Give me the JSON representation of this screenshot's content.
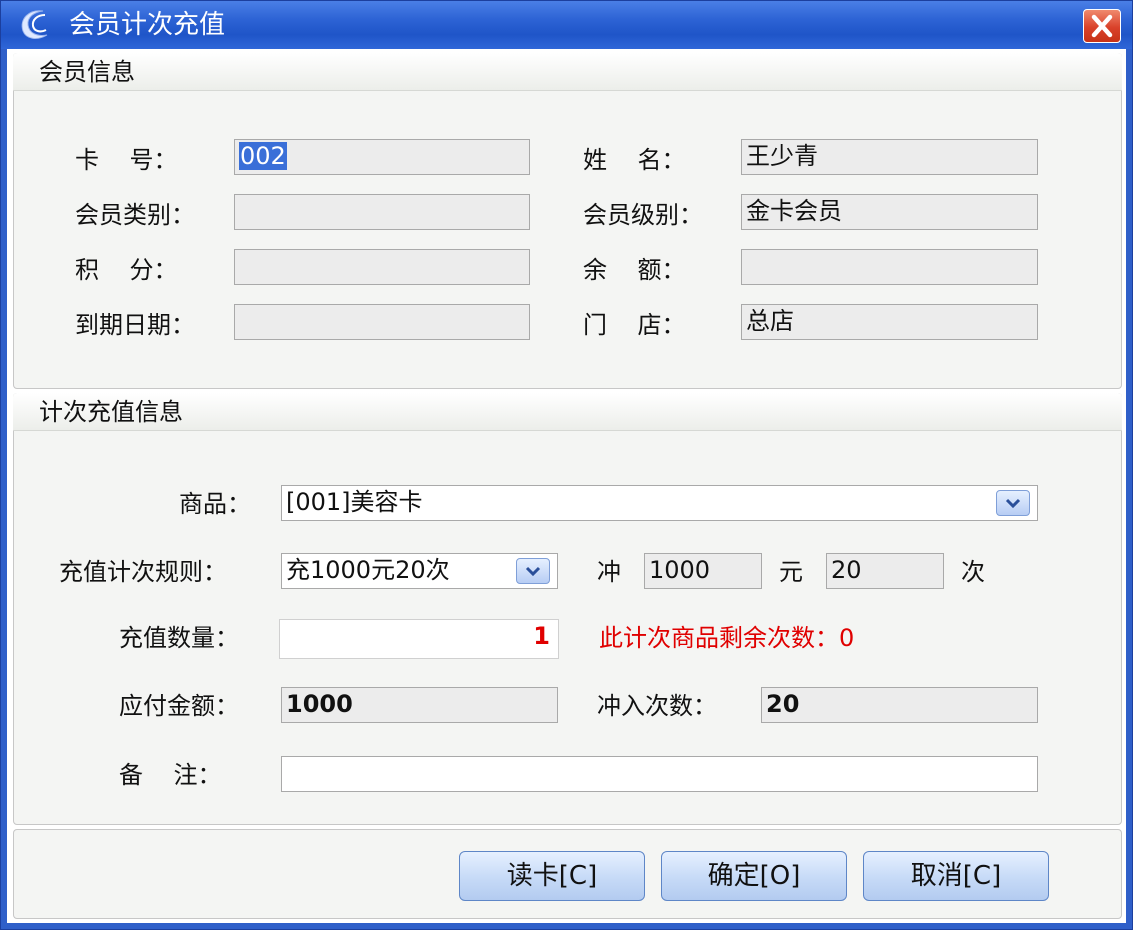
{
  "window": {
    "title": "会员计次充值"
  },
  "member_info": {
    "title": "会员信息",
    "card_no": {
      "label": "卡    号：",
      "value": "002"
    },
    "name": {
      "label": "姓    名：",
      "value": "王少青"
    },
    "category": {
      "label": "会员类别：",
      "value": ""
    },
    "level": {
      "label": "会员级别：",
      "value": "金卡会员"
    },
    "points": {
      "label": "积    分：",
      "value": ""
    },
    "balance": {
      "label": "余    额：",
      "value": ""
    },
    "expiry": {
      "label": "到期日期：",
      "value": ""
    },
    "store": {
      "label": "门    店：",
      "value": "总店"
    }
  },
  "recharge_info": {
    "title": "计次充值信息",
    "product": {
      "label": "商品：",
      "value": "[001]美容卡"
    },
    "rule": {
      "label": "充值计次规则：",
      "value": "充1000元20次"
    },
    "charge_label": "冲",
    "charge_amount": "1000",
    "yuan_label": "元",
    "charge_times": "20",
    "times_label": "次",
    "quantity": {
      "label": "充值数量：",
      "value": "1"
    },
    "remaining_text": "此计次商品剩余次数：0",
    "payable": {
      "label": "应付金额：",
      "value": "1000"
    },
    "charge_count": {
      "label": "冲入次数：",
      "value": "20"
    },
    "remark": {
      "label": "备    注：",
      "value": ""
    }
  },
  "buttons": {
    "read_card": "读卡[C]",
    "confirm": "确定[O]",
    "cancel": "取消[C]"
  },
  "colors": {
    "title_bar": "#2c62d4",
    "panel_bg": "#f4f5f3",
    "warning_red": "#e00000",
    "selection": "#3a6fd8"
  }
}
